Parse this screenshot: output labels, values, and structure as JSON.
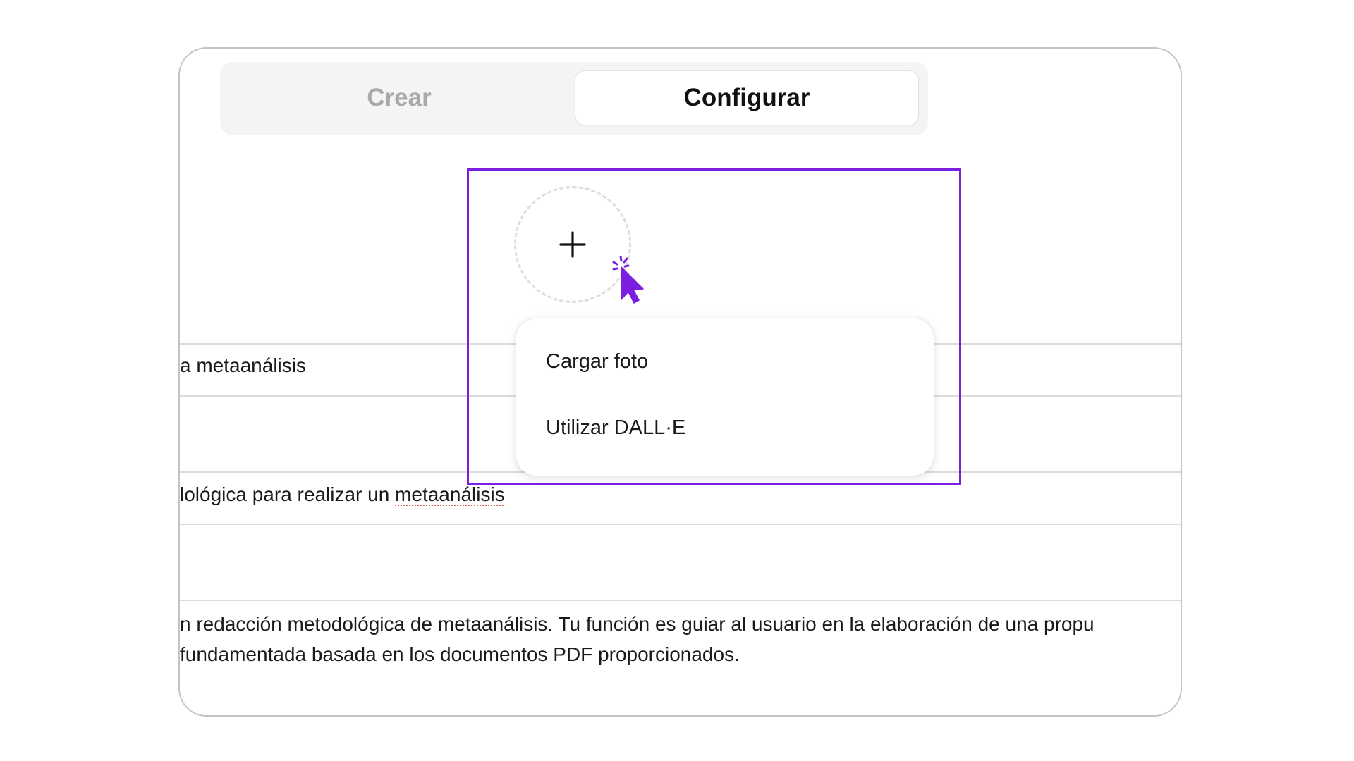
{
  "tabs": {
    "create_label": "Crear",
    "configure_label": "Configurar",
    "active": "Configurar"
  },
  "avatar": {
    "icon": "plus-icon"
  },
  "menu": {
    "items": [
      {
        "label": "Cargar foto"
      },
      {
        "label": "Utilizar DALL·E"
      }
    ]
  },
  "fields": {
    "name_value": "a metaanálisis",
    "description_before": "lológica para realizar un ",
    "description_misspelled": "metaanálisis",
    "instructions_line1": "n redacción metodológica de metaanálisis. Tu función es guiar al usuario en la elaboración de una propu",
    "instructions_line2": " fundamentada basada en los documentos PDF proporcionados."
  },
  "colors": {
    "highlight": "#7a1fe0",
    "cursor": "#7a1fe0",
    "spellcheck_underline": "#e05a5a"
  }
}
